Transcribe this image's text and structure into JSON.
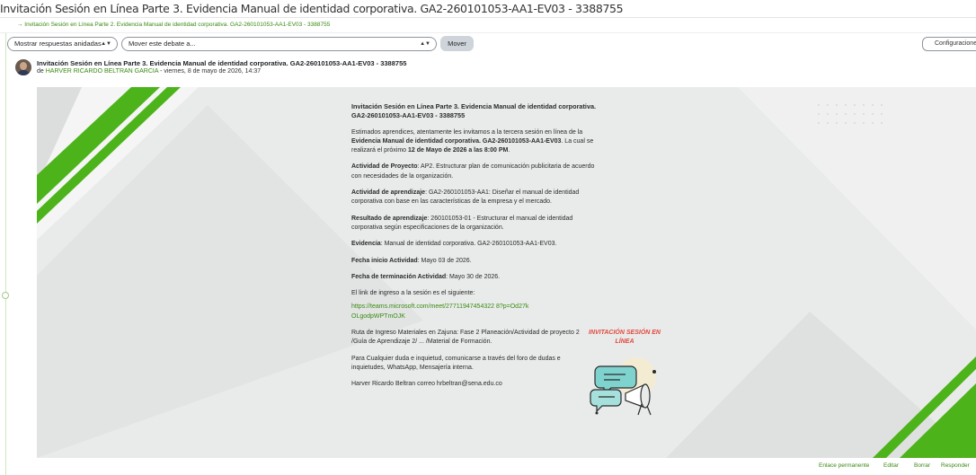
{
  "page": {
    "title": "Invitación Sesión en Línea Parte 3. Evidencia Manual de identidad corporativa. GA2-260101053-AA1-EV03 - 3388755",
    "breadcrumb": "→ Invitación Sesión en Línea Parte 2. Evidencia Manual de identidad corporativa. GA2-260101053-AA1-EV03 - 3388755"
  },
  "toolbar": {
    "display_mode": "Mostrar respuestas anidadas",
    "move_select": "Mover este debate a...",
    "move_button": "Mover",
    "settings": "Configuraciones"
  },
  "post": {
    "subject": "Invitación Sesión en Línea Parte 3. Evidencia Manual de identidad corporativa. GA2-260101053-AA1-EV03 - 3388755",
    "by": "de",
    "author": "HARVER RICARDO BELTRAN GARCIA",
    "date": " - viernes, 8 de mayo de 2026, 14:37"
  },
  "banner": {
    "title": "Invitación Sesión en Línea Parte 3. Evidencia Manual de identidad corporativa. GA2-260101053-AA1-EV03 - 3388755",
    "intro_1": "Estimados aprendices, atentamente les invitamos a la tercera sesión en línea de la ",
    "intro_bold": "Evidencia Manual de identidad corporativa. GA2-260101053-AA1-EV03",
    "intro_2": ". La cual se realizará el próximo ",
    "intro_date": "12 de Mayo de 2026 a las 8:00 PM",
    "intro_3": ".",
    "project_label": "Actividad de Proyecto",
    "project_text": ": AP2. Estructurar plan de comunicación publicitaria de acuerdo con necesidades de la organización.",
    "learning_label": "Actividad de aprendizaje",
    "learning_text": ": GA2-260101053-AA1: Diseñar el manual de identidad corporativa con base en las características de la empresa y el mercado.",
    "result_label": "Resultado de aprendizaje",
    "result_text": ": 260101053-01 - Estructurar el manual de identidad corporativa según especificaciones de la organización.",
    "evidence_label": "Evidencia",
    "evidence_text": ": Manual de identidad corporativa. GA2-260101053-AA1-EV03.",
    "start_label": "Fecha inicio Actividad",
    "start_text": ":  Mayo 03 de 2026.",
    "end_label": "Fecha de terminación Actividad",
    "end_text": ": Mayo 30 de 2026.",
    "link_intro": "El link de ingreso a la sesión es el siguiente:",
    "link": "https://teams.microsoft.com/meet/27711947454322 8?p=Od27kOLgodpWPTmOJK",
    "route": "Ruta de Ingreso Materiales en Zajuna:  Fase 2 Planeación/Actividad de proyecto 2 /Guía de Aprendizaje 2/ ... /Material de Formación.",
    "doubts": "Para Cualquier duda e inquietud, comunicarse a través del foro de dudas e inquietudes, WhatsApp, Mensajería interna.",
    "contact": "Harver Ricardo Beltran correo hrbeltran@sena.edu.co",
    "invite_label": "INVITACIÓN SESIÓN EN LÍNEA"
  },
  "footer": {
    "permalink": "Enlace permanente",
    "edit": "Editar",
    "delete": "Borrar",
    "reply": "Responder"
  },
  "colors": {
    "accent_green": "#3a8a12",
    "stripe_green": "#4db31a",
    "banner_bg": "#e9ebea",
    "invite_red": "#e2483d",
    "bubble_teal": "#7fd3cf"
  },
  "icons": [
    "caret-down-icon",
    "avatar",
    "chat-megaphone-illustration"
  ]
}
